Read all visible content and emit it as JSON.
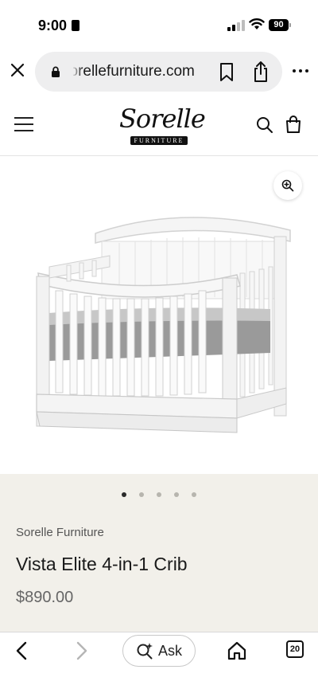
{
  "status_bar": {
    "time": "9:00",
    "battery": "90",
    "icons": [
      "id-badge-icon",
      "cellular-signal-icon",
      "wifi-icon",
      "battery-icon"
    ]
  },
  "browser": {
    "url": "sorellefurniture.com",
    "icons": [
      "close-icon",
      "lock-icon",
      "bookmark-icon",
      "share-icon",
      "more-icon"
    ]
  },
  "site_header": {
    "logo_script": "Sorelle",
    "logo_band": "FURNITURE",
    "icons": [
      "menu-icon",
      "search-icon",
      "shopping-bag-icon"
    ]
  },
  "gallery": {
    "image_count": 5,
    "active_index": 0,
    "icons": [
      "zoom-in-icon"
    ],
    "image_subject": "white convertible crib"
  },
  "product": {
    "brand": "Sorelle Furniture",
    "title": "Vista Elite 4-in-1 Crib",
    "price": "$890.00"
  },
  "bottom_bar": {
    "ask_label": "Ask",
    "tab_count": "20",
    "icons": [
      "back-arrow-icon",
      "forward-arrow-icon",
      "ask-sparkle-search-icon",
      "home-icon",
      "tabs-icon"
    ]
  }
}
